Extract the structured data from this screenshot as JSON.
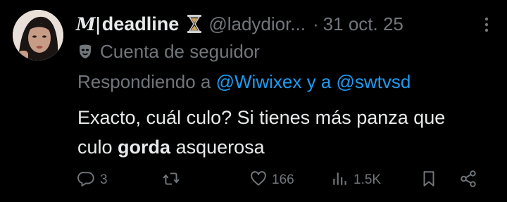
{
  "tweet": {
    "logo": "M|",
    "display_name": "deadline",
    "handle": "@ladydior...",
    "separator": "·",
    "date": "31 oct. 25",
    "subline": "Cuenta de seguidor",
    "replying_prefix": "Respondiendo a",
    "mention_1": "@Wiwixex",
    "and_word": "y a",
    "mention_2": "@swtvsd",
    "body_line1": "Exacto, cuál culo? Si tienes más panza que",
    "body_line2_pre": "culo ",
    "body_line2_bold": "gorda",
    "body_line2_post": " asquerosa"
  },
  "actions": {
    "reply_count": "3",
    "retweet_count": "",
    "like_count": "166",
    "views_count": "1.5K"
  },
  "icons": {
    "verified_badge": "hourglass-icon",
    "follower_badge": "mask-icon",
    "reply": "reply-icon",
    "retweet": "retweet-icon",
    "like": "heart-icon",
    "views": "views-icon",
    "bookmark": "bookmark-icon",
    "share": "share-icon",
    "more": "more-dots-icon"
  },
  "colors": {
    "background": "#000000",
    "text": "#e7e9ea",
    "muted": "#71767b",
    "link": "#1d9bf0"
  }
}
